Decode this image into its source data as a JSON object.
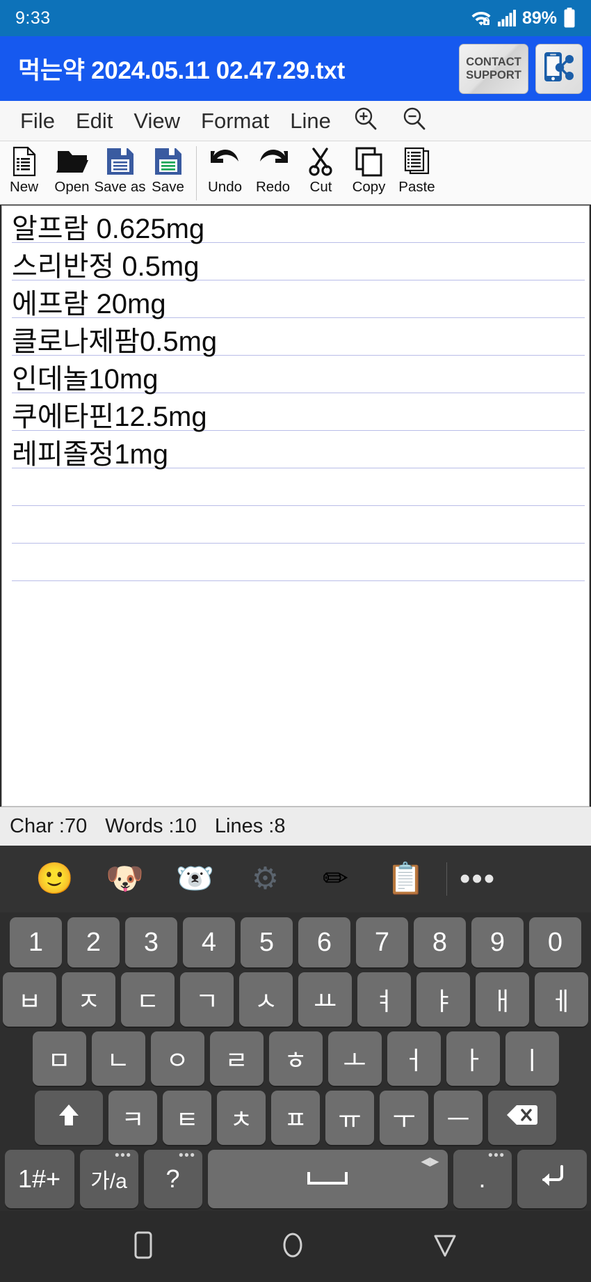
{
  "status_bar": {
    "clock": "9:33",
    "battery_percent": "89%",
    "wifi_icon": "wifi-lock-icon",
    "signal_icon": "signal-bars-icon",
    "battery_icon": "battery-icon"
  },
  "title_bar": {
    "document_title": "먹는약 2024.05.11 02.47.29.txt",
    "contact_support_line1": "CONTACT",
    "contact_support_line2": "SUPPORT",
    "share_icon": "share-phone-icon",
    "background_color": "#1659ef"
  },
  "menu_bar": {
    "items": [
      {
        "label": "File",
        "name": "menu-file"
      },
      {
        "label": "Edit",
        "name": "menu-edit"
      },
      {
        "label": "View",
        "name": "menu-view"
      },
      {
        "label": "Format",
        "name": "menu-format"
      },
      {
        "label": "Line",
        "name": "menu-line"
      }
    ],
    "zoom_in_icon": "zoom-in-icon",
    "zoom_out_icon": "zoom-out-icon"
  },
  "toolbar": {
    "group_file": [
      {
        "label": "New",
        "icon": "new-document-icon"
      },
      {
        "label": "Open",
        "icon": "open-folder-icon"
      },
      {
        "label": "Save as",
        "icon": "floppy-disk-blue-icon"
      },
      {
        "label": "Save",
        "icon": "floppy-disk-green-icon"
      }
    ],
    "group_edit": [
      {
        "label": "Undo",
        "icon": "undo-arrow-icon"
      },
      {
        "label": "Redo",
        "icon": "redo-arrow-icon"
      },
      {
        "label": "Cut",
        "icon": "scissors-icon"
      },
      {
        "label": "Copy",
        "icon": "copy-icon"
      },
      {
        "label": "Paste",
        "icon": "paste-icon"
      }
    ]
  },
  "editor": {
    "lines": [
      "알프람 0.625mg",
      "스리반정 0.5mg",
      "에프람 20mg",
      "클로나제팜0.5mg",
      "인데놀10mg",
      "쿠에타핀12.5mg",
      "레피졸정1mg"
    ],
    "rule_color": "#b9bde8"
  },
  "count_bar": {
    "chars": "Char :70",
    "words": "Words :10",
    "lines": "Lines :8"
  },
  "keyboard": {
    "toolbar_icons": [
      {
        "name": "emoji-smiley-icon",
        "glyph": "🙂"
      },
      {
        "name": "animoji-dog-icon",
        "glyph": "🐶"
      },
      {
        "name": "bear-sticker-icon",
        "glyph": "🐻‍❄️"
      },
      {
        "name": "settings-gear-icon",
        "glyph": "⚙"
      },
      {
        "name": "handwriting-pen-icon",
        "glyph": "✏"
      },
      {
        "name": "clipboard-icon",
        "glyph": "📋"
      }
    ],
    "overflow_label": "•••",
    "number_row": [
      "1",
      "2",
      "3",
      "4",
      "5",
      "6",
      "7",
      "8",
      "9",
      "0"
    ],
    "row1": [
      "ㅂ",
      "ㅈ",
      "ㄷ",
      "ㄱ",
      "ㅅ",
      "ㅛ",
      "ㅕ",
      "ㅑ",
      "ㅐ",
      "ㅔ"
    ],
    "row2": [
      "ㅁ",
      "ㄴ",
      "ㅇ",
      "ㄹ",
      "ㅎ",
      "ㅗ",
      "ㅓ",
      "ㅏ",
      "ㅣ"
    ],
    "row3": [
      "ㅋ",
      "ㅌ",
      "ㅊ",
      "ㅍ",
      "ㅠ",
      "ㅜ",
      "ㅡ"
    ],
    "shift_icon": "shift-up-arrow-icon",
    "backspace_icon": "backspace-icon",
    "bottom_row": {
      "symbols_label": "1#+",
      "language_label": "가/a",
      "question_label": "?",
      "space_icon": "space-bar-icon",
      "period_label": ".",
      "enter_icon": "enter-return-icon"
    }
  },
  "nav_bar": {
    "recents_icon": "recents-square-icon",
    "home_icon": "home-circle-icon",
    "back_icon": "back-triangle-icon"
  }
}
